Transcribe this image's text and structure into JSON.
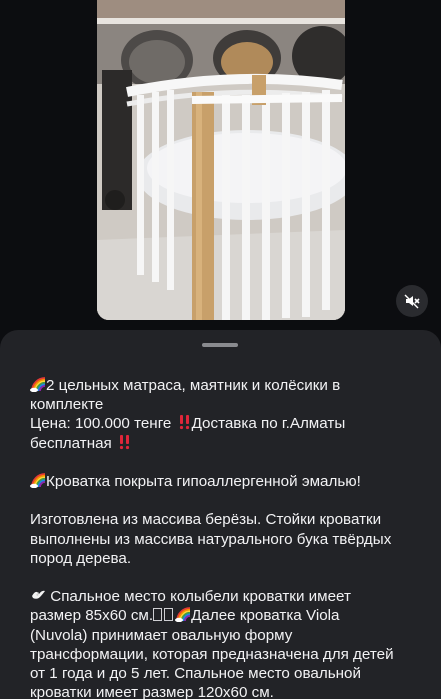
{
  "post": {
    "paragraphs": [
      {
        "lines": [
          {
            "icon": "rainbow-icon",
            "text": "2 цельных матраса, маятник и колёсики в"
          },
          {
            "text": "комплекте"
          },
          {
            "text": "Цена: 100.000 тенге ",
            "icon_after": "double-exclamation-icon",
            "tail": "Доставка по г.Алматы"
          },
          {
            "text": "бесплатная ",
            "icon_after": "double-exclamation-icon"
          }
        ]
      },
      {
        "lines": [
          {
            "icon": "rainbow-icon",
            "text": "Кроватка покрыта гипоаллергенной эмалью!"
          }
        ]
      },
      {
        "lines": [
          {
            "text": "Изготовлена из массива берёзы. Стойки кроватки"
          },
          {
            "text": "выполнены из массива натурального бука твёрдых"
          },
          {
            "text": "пород дерева."
          }
        ]
      },
      {
        "lines": [
          {
            "icon": "dove-icon",
            "text": " Спальное место колыбели кроватки имеет"
          },
          {
            "text": "размер 85х60 см.",
            "boxes": 2,
            "icon_after": "rainbow-icon",
            "tail": "Далее кроватка Viola"
          },
          {
            "text": "(Nuvola) принимает овальную форму"
          },
          {
            "text": "трансформации, которая предназначена для детей"
          },
          {
            "text": "от 1 года и до 5 лет.  Спальное место овальной"
          },
          {
            "text": "кроватки имеет размер 120х60 см."
          }
        ]
      }
    ]
  },
  "colors": {
    "background": "#0c0d10",
    "sheet": "#222327",
    "text": "#f2f2f4",
    "accent_red": "#e0263a"
  },
  "media": {
    "kind": "video",
    "mute_icon": "speaker-muted-icon"
  }
}
